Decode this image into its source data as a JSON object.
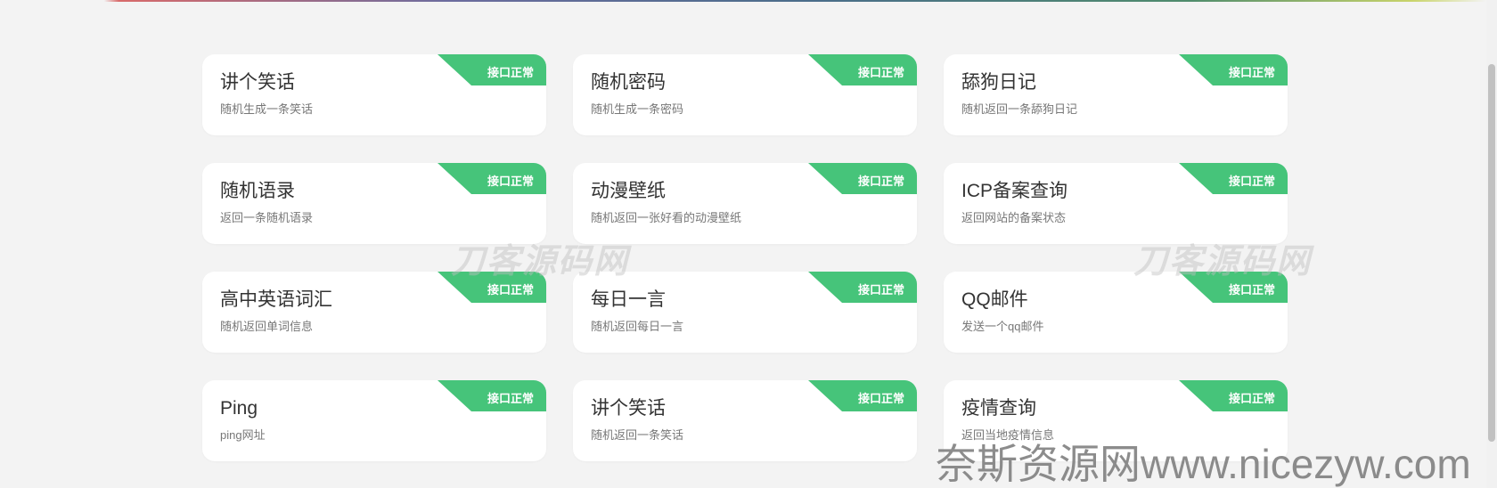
{
  "cards": [
    {
      "title": "讲个笑话",
      "desc": "随机生成一条笑话",
      "status": "接口正常"
    },
    {
      "title": "随机密码",
      "desc": "随机生成一条密码",
      "status": "接口正常"
    },
    {
      "title": "舔狗日记",
      "desc": "随机返回一条舔狗日记",
      "status": "接口正常"
    },
    {
      "title": "随机语录",
      "desc": "返回一条随机语录",
      "status": "接口正常"
    },
    {
      "title": "动漫壁纸",
      "desc": "随机返回一张好看的动漫壁纸",
      "status": "接口正常"
    },
    {
      "title": "ICP备案查询",
      "desc": "返回网站的备案状态",
      "status": "接口正常"
    },
    {
      "title": "高中英语词汇",
      "desc": "随机返回单词信息",
      "status": "接口正常"
    },
    {
      "title": "每日一言",
      "desc": "随机返回每日一言",
      "status": "接口正常"
    },
    {
      "title": "QQ邮件",
      "desc": "发送一个qq邮件",
      "status": "接口正常"
    },
    {
      "title": "Ping",
      "desc": "ping网址",
      "status": "接口正常"
    },
    {
      "title": "讲个笑话",
      "desc": "随机返回一条笑话",
      "status": "接口正常"
    },
    {
      "title": "疫情查询",
      "desc": "返回当地疫情信息",
      "status": "接口正常"
    }
  ],
  "watermarks": {
    "logo_text": "刀客源码网",
    "bottom_text": "奈斯资源网www.nicezyw.com"
  },
  "colors": {
    "badge": "#46c47a",
    "background": "#f3f3f3",
    "card": "#ffffff"
  }
}
